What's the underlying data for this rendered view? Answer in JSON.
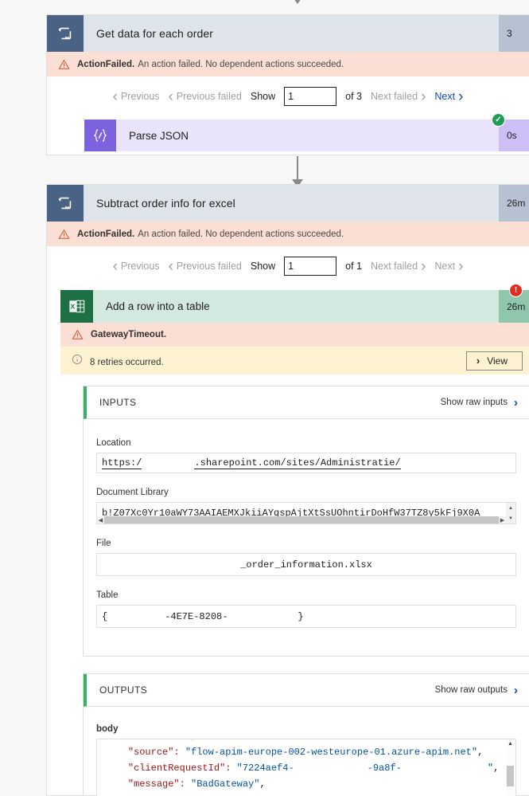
{
  "flow": {
    "scope1": {
      "title": "Get data for each order",
      "icon": "loop-icon",
      "duration": "3",
      "error": {
        "code": "ActionFailed.",
        "message": "An action failed. No dependent actions succeeded."
      },
      "pager": {
        "previous": "Previous",
        "previous_failed": "Previous failed",
        "show_label": "Show",
        "page_value": "1",
        "of_label": "of 3",
        "next_failed": "Next failed",
        "next": "Next"
      },
      "child_action": {
        "title": "Parse JSON",
        "icon": "json-braces-icon",
        "duration": "0s",
        "status": "succeeded",
        "status_glyph": "✓"
      }
    },
    "scope2": {
      "title": "Subtract order info for excel",
      "icon": "loop-icon",
      "duration": "26m",
      "error": {
        "code": "ActionFailed.",
        "message": "An action failed. No dependent actions succeeded."
      },
      "pager": {
        "previous": "Previous",
        "previous_failed": "Previous failed",
        "show_label": "Show",
        "page_value": "1",
        "of_label": "of 1",
        "next_failed": "Next failed",
        "next": "Next"
      },
      "excel_action": {
        "title": "Add a row into a table",
        "icon": "excel-icon",
        "duration": "26m",
        "status": "failed",
        "status_glyph": "!",
        "error": {
          "code": "GatewayTimeout."
        },
        "retries": {
          "text": "8 retries occurred.",
          "view_button": "View"
        }
      }
    }
  },
  "inputs": {
    "heading": "INPUTS",
    "raw_link": "Show raw inputs",
    "fields": [
      {
        "label": "Location",
        "value_prefix": "https:/",
        "value_suffix": ".sharepoint.com/sites/Administratie/"
      },
      {
        "label": "Document Library",
        "value": "b!Z07Xc0Yr10aWY73AAIAEMXJkiiAYqspAjtXtSsUOhntirDoHfW37TZ8y5kFj9X0A"
      },
      {
        "label": "File",
        "value": "_order_information.xlsx"
      },
      {
        "label": "Table",
        "value_open": "{",
        "value_mid": "-4E7E-8208-",
        "value_close": "}"
      }
    ]
  },
  "outputs": {
    "heading": "OUTPUTS",
    "raw_link": "Show raw outputs",
    "body_label": "body",
    "lines": [
      {
        "key": "\"source\":",
        "value": "\"flow-apim-europe-002-westeurope-01.azure-apim.net\"",
        "comma": ","
      },
      {
        "key": "\"clientRequestId\":",
        "value_start": "\"7224aef4-",
        "value_mid": "-9a8f-",
        "value_end": "\"",
        "comma": ","
      },
      {
        "key": "\"message\":",
        "value": "\"BadGateway\"",
        "comma": ","
      }
    ]
  },
  "colors": {
    "scope_header": "#dfe3ea",
    "scope_icon": "#4a6285",
    "error_strip": "#fbdfd4",
    "warn_strip": "#fdf3d3",
    "excel_green": "#d3e8de",
    "excel_icon": "#1d7044",
    "json_purple": "#7d62e0",
    "link_blue": "#0f4ab5",
    "success_green": "#1f9d55",
    "error_red": "#e32b22"
  }
}
